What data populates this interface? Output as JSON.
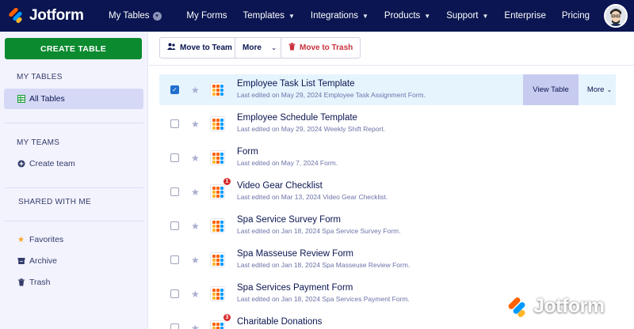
{
  "app": {
    "brand": "Jotform",
    "switcher_label": "My Tables"
  },
  "nav": {
    "items": [
      {
        "label": "My Forms",
        "caret": false
      },
      {
        "label": "Templates",
        "caret": true
      },
      {
        "label": "Integrations",
        "caret": true
      },
      {
        "label": "Products",
        "caret": true
      },
      {
        "label": "Support",
        "caret": true
      },
      {
        "label": "Enterprise",
        "caret": false
      },
      {
        "label": "Pricing",
        "caret": false
      }
    ]
  },
  "sidebar": {
    "create_label": "CREATE TABLE",
    "my_tables_title": "MY TABLES",
    "all_tables_label": "All Tables",
    "my_teams_title": "MY TEAMS",
    "create_team_label": "Create team",
    "shared_title": "SHARED WITH ME",
    "favorites_label": "Favorites",
    "archive_label": "Archive",
    "trash_label": "Trash"
  },
  "toolbar": {
    "move_team_label": "Move to Team",
    "more_label": "More",
    "trash_label": "Move to Trash"
  },
  "rows": [
    {
      "title": "Employee Task List Template",
      "date": "Last edited on May 29, 2024",
      "source": "Employee Task Assignment Form.",
      "selected": true,
      "badge": ""
    },
    {
      "title": "Employee Schedule Template",
      "date": "Last edited on May 29, 2024",
      "source": "Weekly Shift Report.",
      "selected": false,
      "badge": ""
    },
    {
      "title": "Form",
      "date": "Last edited on May 7, 2024",
      "source": "Form.",
      "selected": false,
      "badge": ""
    },
    {
      "title": "Video Gear Checklist",
      "date": "Last edited on Mar 13, 2024",
      "source": "Video Gear Checklist.",
      "selected": false,
      "badge": "1"
    },
    {
      "title": "Spa Service Survey Form",
      "date": "Last edited on Jan 18, 2024",
      "source": "Spa Service Survey Form.",
      "selected": false,
      "badge": ""
    },
    {
      "title": "Spa Masseuse Review Form",
      "date": "Last edited on Jan 18, 2024",
      "source": "Spa Masseuse Review Form.",
      "selected": false,
      "badge": ""
    },
    {
      "title": "Spa Services Payment Form",
      "date": "Last edited on Jan 18, 2024",
      "source": "Spa Services Payment Form.",
      "selected": false,
      "badge": ""
    },
    {
      "title": "Charitable Donations",
      "date": "",
      "source": "",
      "selected": false,
      "badge": "3"
    }
  ],
  "row_actions": {
    "view_label": "View Table",
    "more_label": "More"
  },
  "watermark": {
    "text": "Jotform"
  },
  "colors": {
    "nav_bg": "#0a1551",
    "create_green": "#0c8a30",
    "selected_row": "#e6f4fe",
    "view_button": "#c7cbef",
    "trash_red": "#c9313d"
  },
  "icons": {
    "checkbox": "checkbox-icon",
    "star": "star-icon",
    "table": "table-grid-icon",
    "move_team": "team-move-icon",
    "trash": "trash-icon",
    "chevron": "chevron-down-icon"
  }
}
